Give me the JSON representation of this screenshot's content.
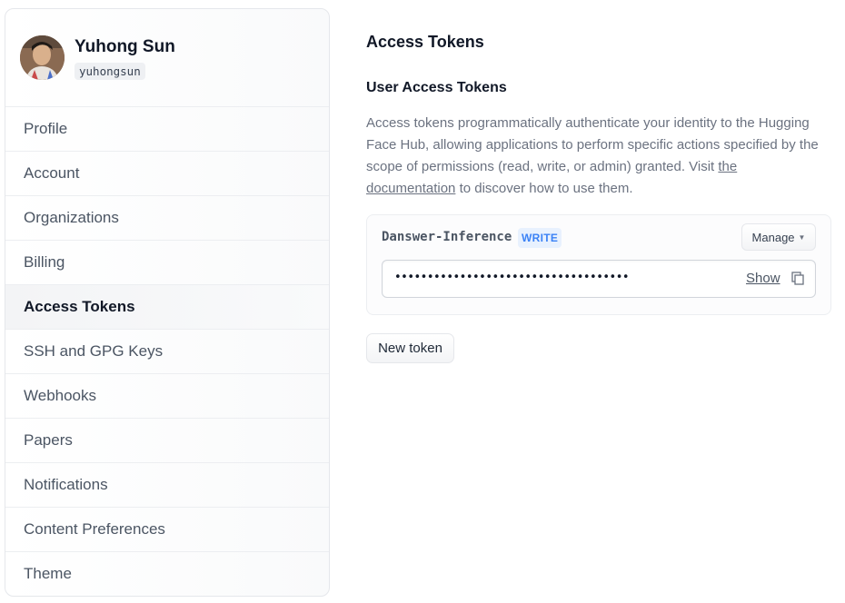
{
  "user": {
    "name": "Yuhong Sun",
    "handle": "yuhongsun"
  },
  "sidebar": {
    "items": [
      {
        "label": "Profile",
        "active": false
      },
      {
        "label": "Account",
        "active": false
      },
      {
        "label": "Organizations",
        "active": false
      },
      {
        "label": "Billing",
        "active": false
      },
      {
        "label": "Access Tokens",
        "active": true
      },
      {
        "label": "SSH and GPG Keys",
        "active": false
      },
      {
        "label": "Webhooks",
        "active": false
      },
      {
        "label": "Papers",
        "active": false
      },
      {
        "label": "Notifications",
        "active": false
      },
      {
        "label": "Content Preferences",
        "active": false
      },
      {
        "label": "Theme",
        "active": false
      }
    ]
  },
  "main": {
    "title": "Access Tokens",
    "section_title": "User Access Tokens",
    "description_pre": "Access tokens programmatically authenticate your identity to the Hugging Face Hub, allowing applications to perform specific actions specified by the scope of permissions (read, write, or admin) granted. Visit ",
    "description_link": "the documentation",
    "description_post": " to discover how to use them.",
    "token": {
      "name": "Danswer-Inference",
      "role": "WRITE",
      "manage_label": "Manage",
      "masked_value": "••••••••••••••••••••••••••••••••••••",
      "show_label": "Show"
    },
    "new_token_label": "New token"
  },
  "icons": {
    "caret": "chevron-down-icon",
    "copy": "copy-icon"
  },
  "colors": {
    "accent_blue": "#3b82f6",
    "role_badge_bg": "#e8f1fe"
  }
}
